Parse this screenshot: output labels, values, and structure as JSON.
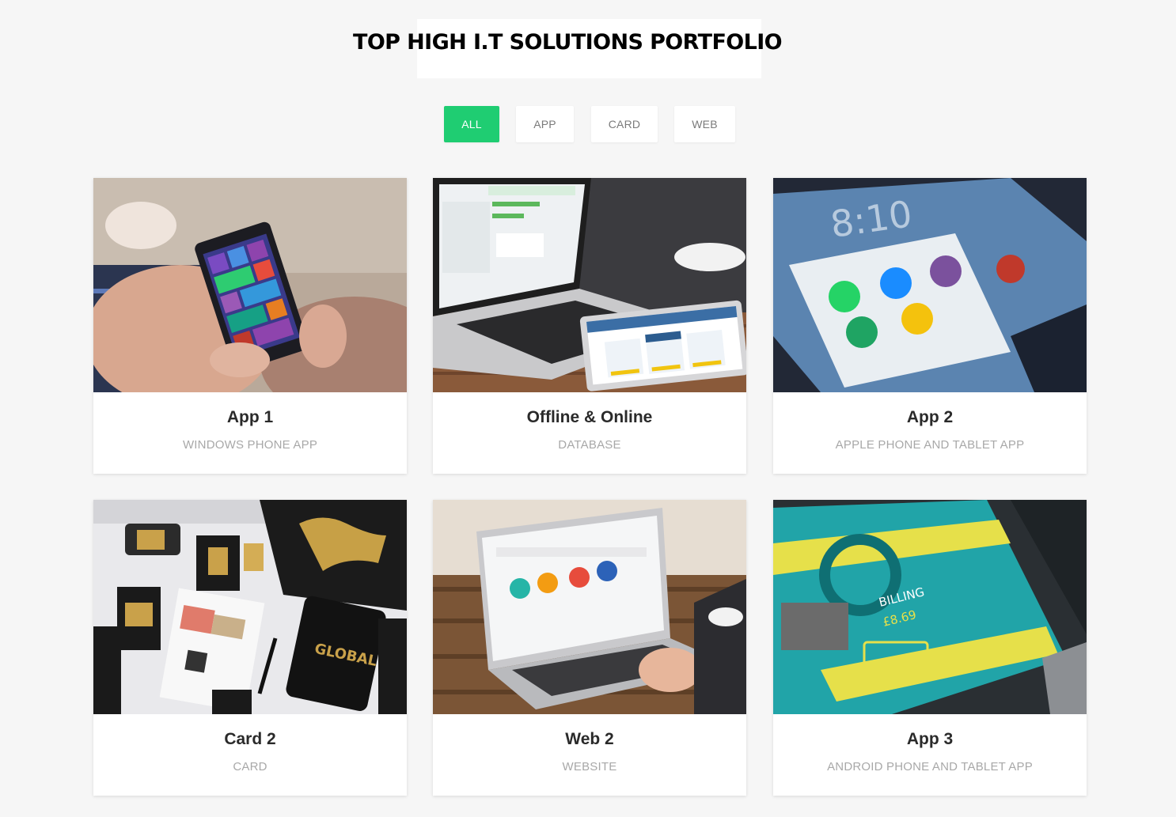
{
  "header": {
    "title": "TOP HIGH I.T SOLUTIONS PORTFOLIO"
  },
  "filters": {
    "active": "ALL",
    "items": [
      {
        "label": "ALL"
      },
      {
        "label": "APP"
      },
      {
        "label": "CARD"
      },
      {
        "label": "WEB"
      }
    ]
  },
  "accent_color": "#1fcd72",
  "portfolio": {
    "items": [
      {
        "title": "App 1",
        "subtitle": "WINDOWS PHONE APP",
        "image": "windows-phone-photo"
      },
      {
        "title": "Offline & Online",
        "subtitle": "DATABASE",
        "image": "laptop-tablet-database-photo"
      },
      {
        "title": "App 2",
        "subtitle": "APPLE PHONE AND TABLET APP",
        "image": "tablet-apps-photo"
      },
      {
        "title": "Card 2",
        "subtitle": "CARD",
        "image": "gold-cards-photo"
      },
      {
        "title": "Web 2",
        "subtitle": "WEBSITE",
        "image": "laptop-website-photo"
      },
      {
        "title": "App 3",
        "subtitle": "ANDROID PHONE AND TABLET APP",
        "image": "android-phone-photo"
      }
    ]
  }
}
